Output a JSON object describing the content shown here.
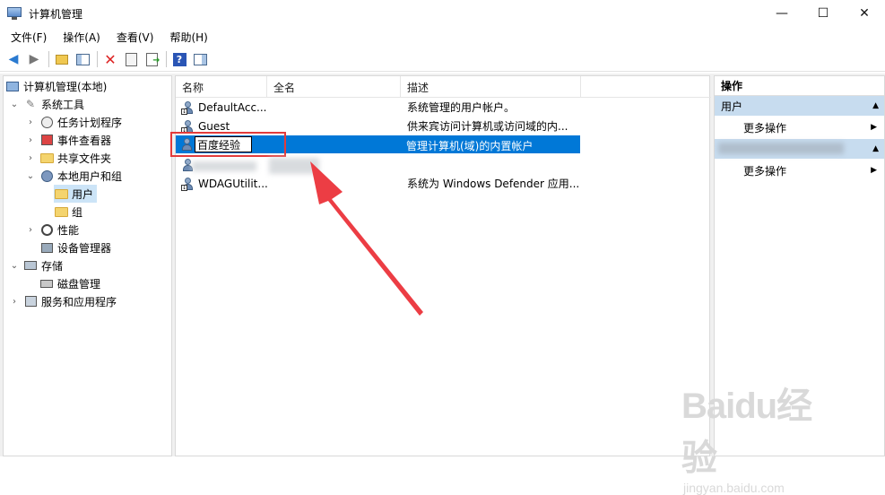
{
  "window": {
    "title": "计算机管理"
  },
  "menu": [
    "文件(F)",
    "操作(A)",
    "查看(V)",
    "帮助(H)"
  ],
  "tree": {
    "root": "计算机管理(本地)",
    "system_tools": "系统工具",
    "task_scheduler": "任务计划程序",
    "event_viewer": "事件查看器",
    "shared_folders": "共享文件夹",
    "local_users_groups": "本地用户和组",
    "users": "用户",
    "groups": "组",
    "performance": "性能",
    "device_manager": "设备管理器",
    "storage": "存储",
    "disk_management": "磁盘管理",
    "services_apps": "服务和应用程序"
  },
  "list": {
    "columns": [
      "名称",
      "全名",
      "描述"
    ],
    "rows": [
      {
        "name": "DefaultAcc...",
        "fullname": "",
        "desc": "系统管理的用户帐户。"
      },
      {
        "name": "Guest",
        "fullname": "",
        "desc": "供来宾访问计算机或访问域的内..."
      },
      {
        "name": "百度经验",
        "fullname": "",
        "desc": "管理计算机(域)的内置帐户"
      },
      {
        "name": "",
        "fullname": "",
        "desc": ""
      },
      {
        "name": "WDAGUtilit...",
        "fullname": "",
        "desc": "系统为 Windows Defender 应用..."
      }
    ]
  },
  "actions": {
    "title": "操作",
    "section1": "用户",
    "more1": "更多操作",
    "more2": "更多操作"
  },
  "watermark": {
    "brand": "Baidu经验",
    "url": "jingyan.baidu.com"
  },
  "colors": {
    "selection": "#0078d7",
    "highlight_box": "#e33b3b",
    "action_header": "#c7dcef"
  }
}
